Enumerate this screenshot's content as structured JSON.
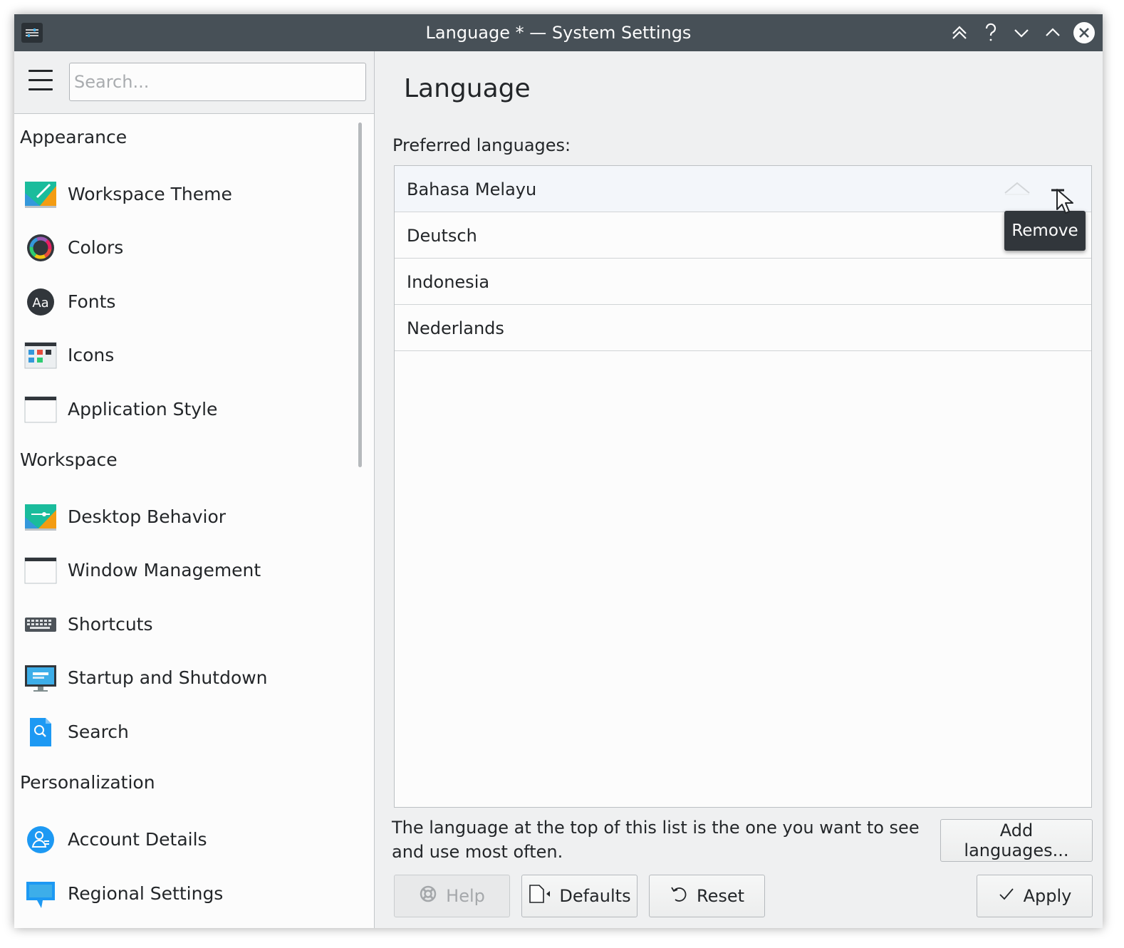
{
  "window": {
    "title": "Language * — System Settings"
  },
  "titlebar": {
    "buttons": [
      "keep-above-icon",
      "help-icon",
      "minimize-icon",
      "maximize-icon",
      "close-icon"
    ]
  },
  "sidebar": {
    "search_placeholder": "Search...",
    "categories": [
      {
        "header": "Appearance",
        "items": [
          {
            "label": "Workspace Theme",
            "icon": "workspace-theme-icon"
          },
          {
            "label": "Colors",
            "icon": "colors-icon"
          },
          {
            "label": "Fonts",
            "icon": "fonts-icon"
          },
          {
            "label": "Icons",
            "icon": "icons-icon"
          },
          {
            "label": "Application Style",
            "icon": "application-style-icon"
          }
        ]
      },
      {
        "header": "Workspace",
        "items": [
          {
            "label": "Desktop Behavior",
            "icon": "desktop-behavior-icon"
          },
          {
            "label": "Window Management",
            "icon": "window-management-icon"
          },
          {
            "label": "Shortcuts",
            "icon": "keyboard-icon"
          },
          {
            "label": "Startup and Shutdown",
            "icon": "monitor-icon"
          },
          {
            "label": "Search",
            "icon": "search-icon"
          }
        ]
      },
      {
        "header": "Personalization",
        "items": [
          {
            "label": "Account Details",
            "icon": "user-icon"
          },
          {
            "label": "Regional Settings",
            "icon": "flag-icon"
          }
        ]
      }
    ]
  },
  "main": {
    "title": "Language",
    "preferred_label": "Preferred languages:",
    "languages": [
      "Bahasa Melayu",
      "Deutsch",
      "Indonesia",
      "Nederlands"
    ],
    "tooltip": "Remove",
    "hint": "The language at the top of this list is the one you want to see and use most often.",
    "add_button": "Add languages...",
    "buttons": {
      "help": "Help",
      "defaults": "Defaults",
      "reset": "Reset",
      "apply": "Apply"
    }
  },
  "colors": {
    "titlebar": "#475057",
    "sidebar_bg": "#fcfcfc",
    "window_bg": "#eff0f1",
    "tooltip_bg": "#31363b",
    "text": "#232629"
  }
}
